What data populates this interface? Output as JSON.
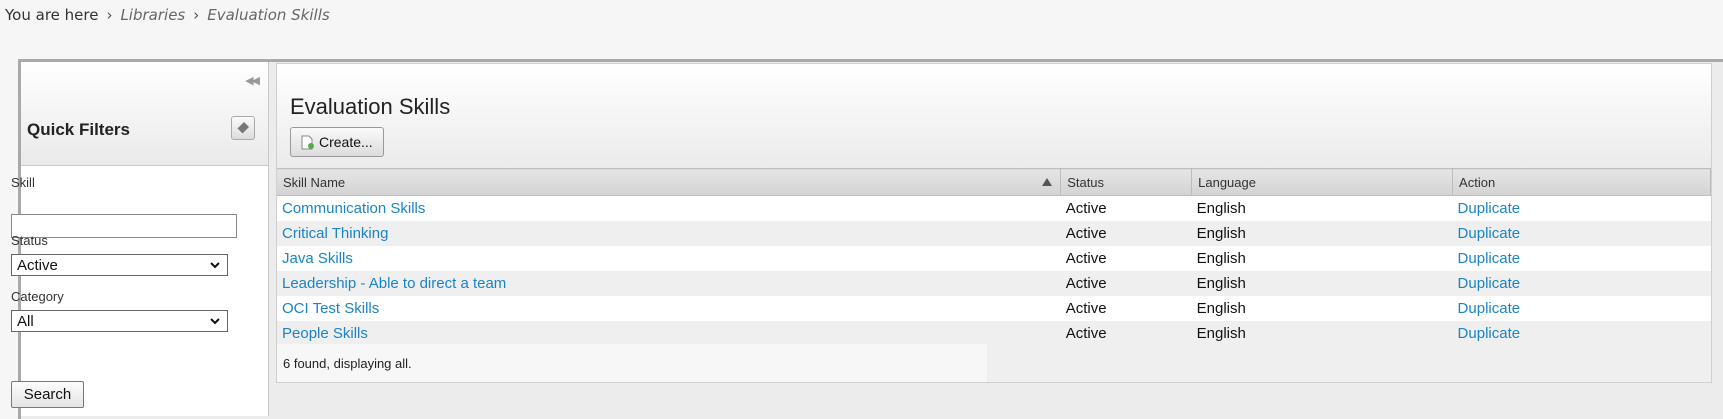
{
  "breadcrumb": {
    "prefix": "You are here",
    "items": [
      "Libraries",
      "Evaluation Skills"
    ]
  },
  "quick_filters": {
    "title": "Quick Filters",
    "skill_label": "Skill",
    "skill_value": "",
    "status_label": "Status",
    "status_value": "Active",
    "category_label": "Category",
    "category_value": "All",
    "search_label": "Search"
  },
  "main": {
    "title": "Evaluation Skills",
    "create_label": "Create...",
    "columns": [
      "Skill Name",
      "Status",
      "Language",
      "Action"
    ],
    "rows": [
      {
        "name": "Communication Skills",
        "status": "Active",
        "language": "English",
        "action": "Duplicate"
      },
      {
        "name": "Critical Thinking",
        "status": "Active",
        "language": "English",
        "action": "Duplicate"
      },
      {
        "name": "Java Skills",
        "status": "Active",
        "language": "English",
        "action": "Duplicate"
      },
      {
        "name": "Leadership - Able to direct a team",
        "status": "Active",
        "language": "English",
        "action": "Duplicate"
      },
      {
        "name": "OCI Test Skills",
        "status": "Active",
        "language": "English",
        "action": "Duplicate"
      },
      {
        "name": "People Skills",
        "status": "Active",
        "language": "English",
        "action": "Duplicate"
      }
    ],
    "footer_text": "6 found, displaying all."
  },
  "colors": {
    "link": "#1a84c7",
    "header_bg": "#d9d9d9",
    "page_bg": "#f6f6f6"
  }
}
